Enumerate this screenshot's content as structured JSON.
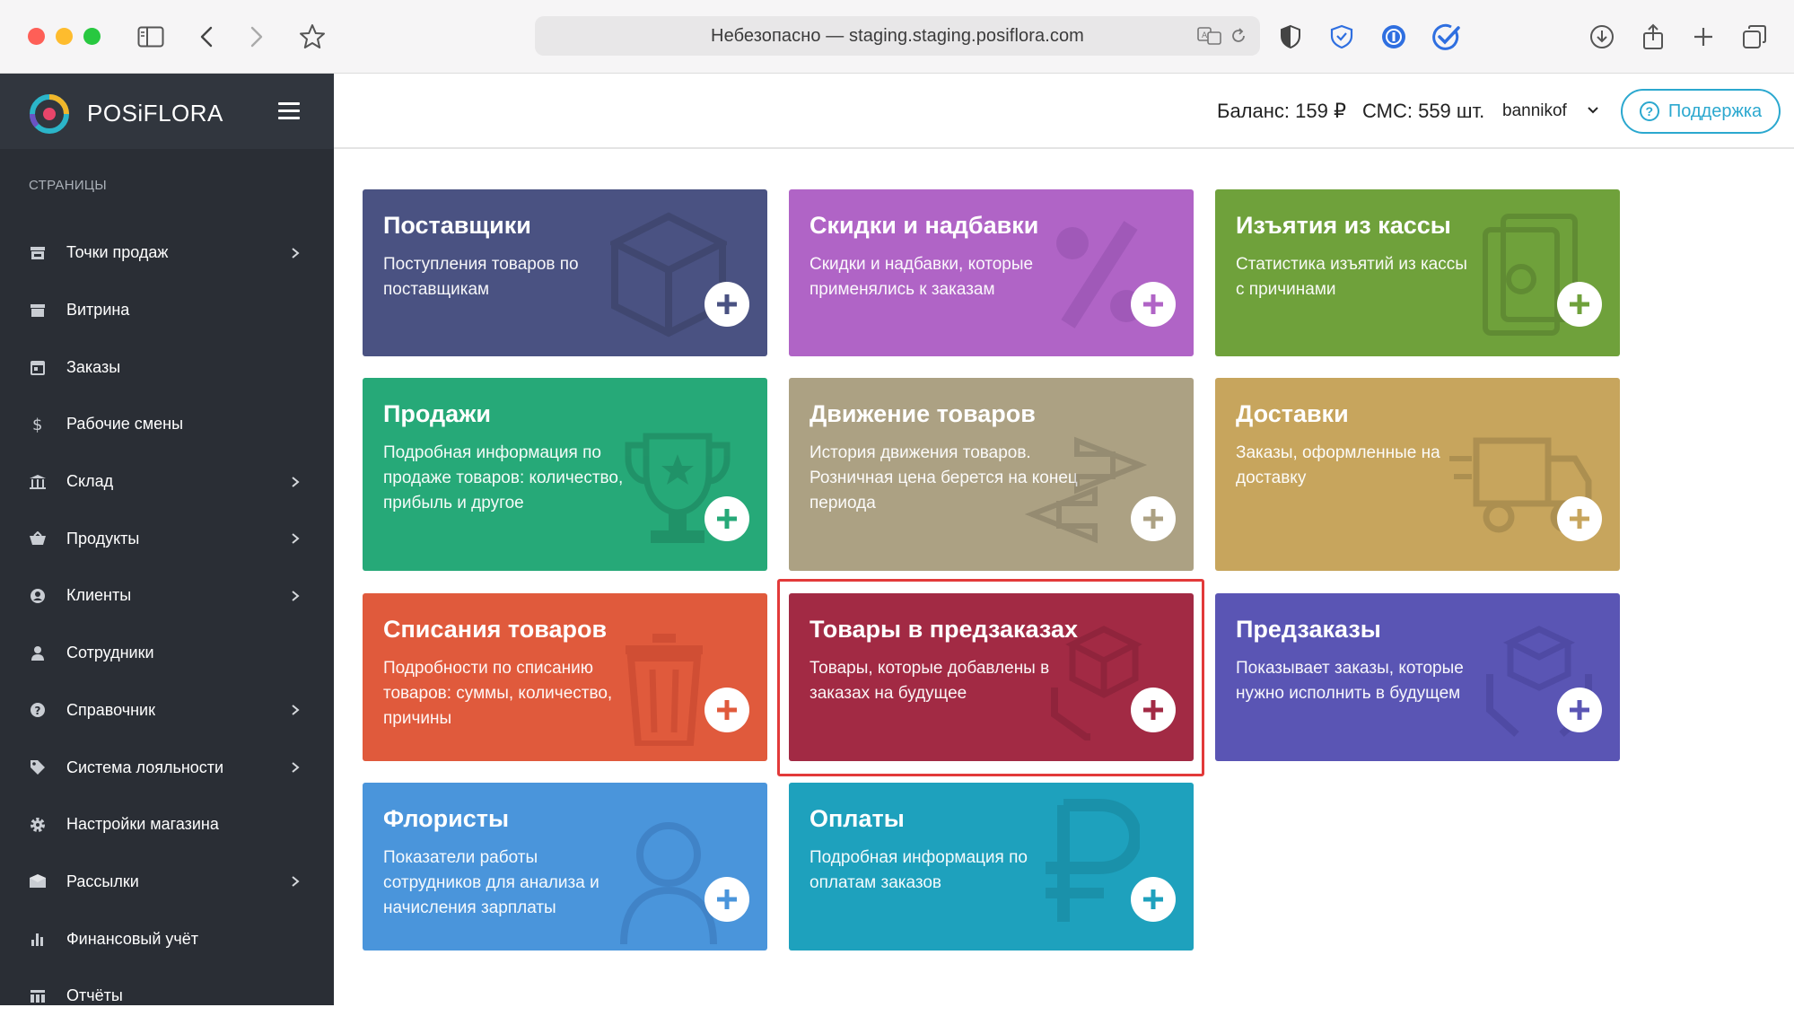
{
  "browser": {
    "address": "Небезопасно — staging.staging.posiflora.com"
  },
  "sidebar": {
    "logo": "POSiFLORA",
    "section": "СТРАНИЦЫ",
    "items": [
      {
        "label": "Точки продаж",
        "icon": "store-icon",
        "chevron": true
      },
      {
        "label": "Витрина",
        "icon": "showcase-icon",
        "chevron": false
      },
      {
        "label": "Заказы",
        "icon": "calendar-icon",
        "chevron": false
      },
      {
        "label": "Рабочие смены",
        "icon": "dollar-icon",
        "chevron": false
      },
      {
        "label": "Склад",
        "icon": "warehouse-icon",
        "chevron": true
      },
      {
        "label": "Продукты",
        "icon": "basket-icon",
        "chevron": true
      },
      {
        "label": "Клиенты",
        "icon": "client-icon",
        "chevron": true
      },
      {
        "label": "Сотрудники",
        "icon": "person-icon",
        "chevron": false
      },
      {
        "label": "Справочник",
        "icon": "question-icon",
        "chevron": true
      },
      {
        "label": "Система лояльности",
        "icon": "tag-icon",
        "chevron": true
      },
      {
        "label": "Настройки магазина",
        "icon": "gear-icon",
        "chevron": false
      },
      {
        "label": "Рассылки",
        "icon": "mail-icon",
        "chevron": true
      },
      {
        "label": "Финансовый учёт",
        "icon": "bar-chart-icon",
        "chevron": false
      },
      {
        "label": "Отчёты",
        "icon": "table-icon",
        "chevron": false
      }
    ]
  },
  "header": {
    "balance": "Баланс: 159 ₽",
    "sms": "СМС: 559 шт.",
    "user": "bannikof",
    "support": "Поддержка"
  },
  "cards": [
    {
      "title": "Поставщики",
      "desc": "Поступления товаров по поставщикам",
      "color": "#4a5282",
      "icon": "box-icon"
    },
    {
      "title": "Скидки и надбавки",
      "desc": "Скидки и надбавки, которые применялись к заказам",
      "color": "#b064c6",
      "icon": "percent-icon"
    },
    {
      "title": "Изъятия из кассы",
      "desc": "Статистика изъятий из кассы с причинами",
      "color": "#6fa13b",
      "icon": "cash-icon"
    },
    {
      "title": "Продажи",
      "desc": "Подробная информация по продаже товаров: количество, прибыль и другое",
      "color": "#26a978",
      "icon": "trophy-icon"
    },
    {
      "title": "Движение товаров",
      "desc": "История движения товаров. Розничная цена берется на конец периода",
      "color": "#aca183",
      "icon": "arrows-icon"
    },
    {
      "title": "Доставки",
      "desc": "Заказы, оформленные на доставку",
      "color": "#c7a55d",
      "icon": "truck-icon"
    },
    {
      "title": "Списания товаров",
      "desc": "Подробности по списанию товаров: суммы, количество, причины",
      "color": "#e05a3c",
      "icon": "trash-icon"
    },
    {
      "title": "Товары в предзаказах",
      "desc": "Товары, которые добавлены в заказах на будущее",
      "color": "#a22a44",
      "icon": "hand-box-icon"
    },
    {
      "title": "Предзаказы",
      "desc": "Показывает заказы, которые нужно исполнить в будущем",
      "color": "#5a55b4",
      "icon": "hands-box-icon"
    },
    {
      "title": "Флористы",
      "desc": "Показатели работы сотрудников для анализа и начисления зарплаты",
      "color": "#4a95db",
      "icon": "user-icon"
    },
    {
      "title": "Оплаты",
      "desc": "Подробная информация по оплатам заказов",
      "color": "#1ea1bd",
      "icon": "ruble-icon"
    }
  ]
}
